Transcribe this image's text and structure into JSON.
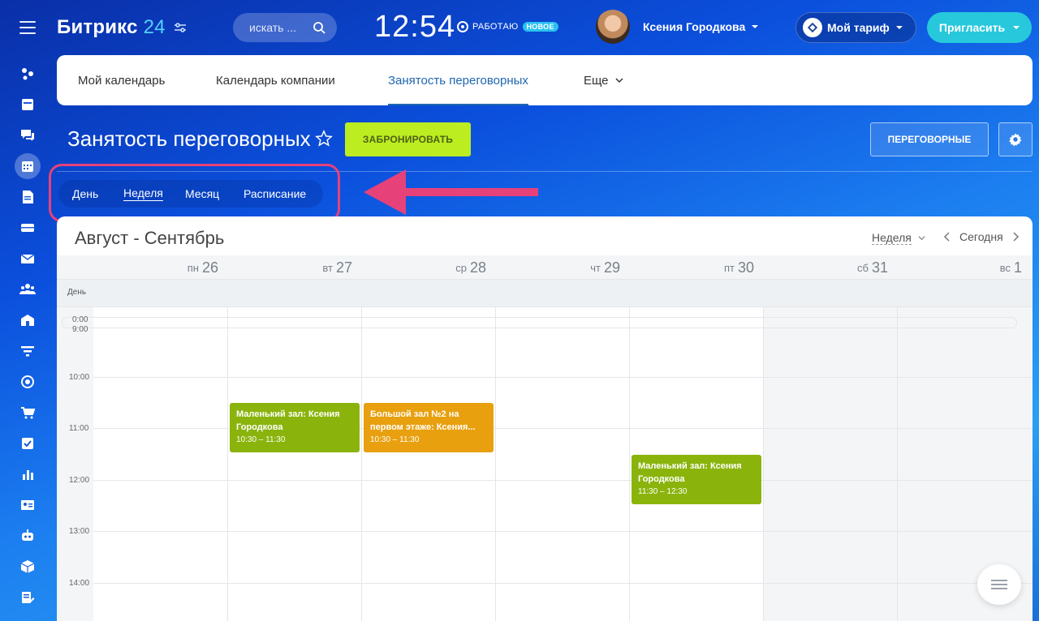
{
  "header": {
    "logo_main": "Битрикс",
    "logo_num": "24",
    "search_placeholder": "искать ...",
    "clock": "12:54",
    "work_status": "РАБОТАЮ",
    "new_badge": "НОВОЕ",
    "user_name": "Ксения Городкова",
    "tariff": "Мой тариф",
    "invite": "Пригласить"
  },
  "nav": {
    "tabs": [
      {
        "label": "Мой календарь"
      },
      {
        "label": "Календарь компании"
      },
      {
        "label": "Занятость переговорных"
      },
      {
        "label": "Еще"
      }
    ],
    "active": "Занятость переговорных"
  },
  "page": {
    "title": "Занятость переговорных",
    "book_button": "ЗАБРОНИРОВАТЬ",
    "rooms_button": "ПЕРЕГОВОРНЫЕ"
  },
  "view_switch": {
    "items": [
      {
        "label": "День"
      },
      {
        "label": "Неделя"
      },
      {
        "label": "Месяц"
      },
      {
        "label": "Расписание"
      }
    ],
    "active": "Неделя"
  },
  "calendar": {
    "range_title": "Август - Сентябрь",
    "view_selector": "Неделя",
    "today": "Сегодня",
    "allday_label": "День",
    "days": [
      {
        "weekday": "пн",
        "num": "26"
      },
      {
        "weekday": "вт",
        "num": "27"
      },
      {
        "weekday": "ср",
        "num": "28"
      },
      {
        "weekday": "чт",
        "num": "29"
      },
      {
        "weekday": "пт",
        "num": "30"
      },
      {
        "weekday": "сб",
        "num": "31"
      },
      {
        "weekday": "вс",
        "num": "1"
      }
    ],
    "time_labels": [
      "0:00",
      "9:00",
      "10:00",
      "11:00",
      "12:00",
      "13:00",
      "14:00"
    ],
    "events": [
      {
        "title": "Маленький зал: Ксения Городкова",
        "time": "10:30 – 11:30",
        "color": "#8ab40c"
      },
      {
        "title": "Большой зал №2 на первом этаже: Ксения...",
        "time": "10:30 – 11:30",
        "color": "#e8a00f"
      },
      {
        "title": "Маленький зал: Ксения Городкова",
        "time": "11:30 – 12:30",
        "color": "#8ab40c"
      }
    ]
  },
  "colors": {
    "accent_green": "#bbed21",
    "highlight_pink": "#e7417a",
    "tab_active": "#2067b0",
    "invite_teal": "#27c8dc"
  }
}
